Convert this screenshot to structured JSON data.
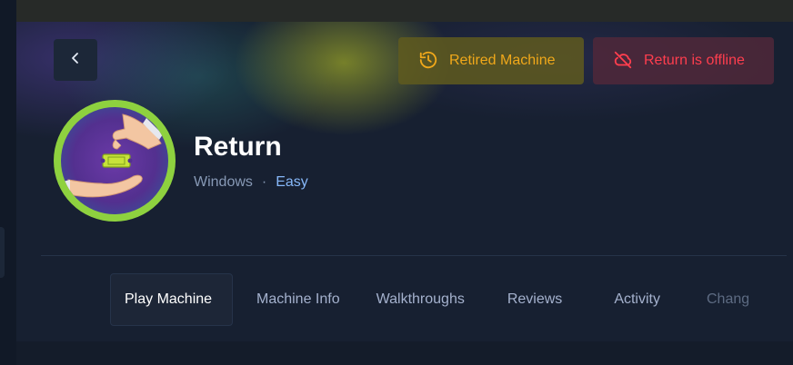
{
  "top_banner": {
    "text": "- - ' - -  - -  - -   - - - - - -   ' -  - - - -   - -"
  },
  "header": {
    "back_label": "‹",
    "retired_label": "Retired Machine",
    "offline_label": "Return is offline"
  },
  "machine": {
    "name": "Return",
    "os": "Windows",
    "separator": "·",
    "difficulty": "Easy"
  },
  "tabs": [
    {
      "label": "Play Machine"
    },
    {
      "label": "Machine Info"
    },
    {
      "label": "Walkthroughs"
    },
    {
      "label": "Reviews"
    },
    {
      "label": "Activity"
    },
    {
      "label": "Chang"
    }
  ],
  "colors": {
    "retired_text": "#f0a81a",
    "offline_text": "#ff3e4e",
    "difficulty_text": "#86b7f8",
    "avatar_ring": "#8ed13f"
  },
  "icons": {
    "back": "chevron-left-icon",
    "retired": "history-icon",
    "offline": "cloud-off-icon",
    "avatar": "hand-ticket-icon"
  }
}
